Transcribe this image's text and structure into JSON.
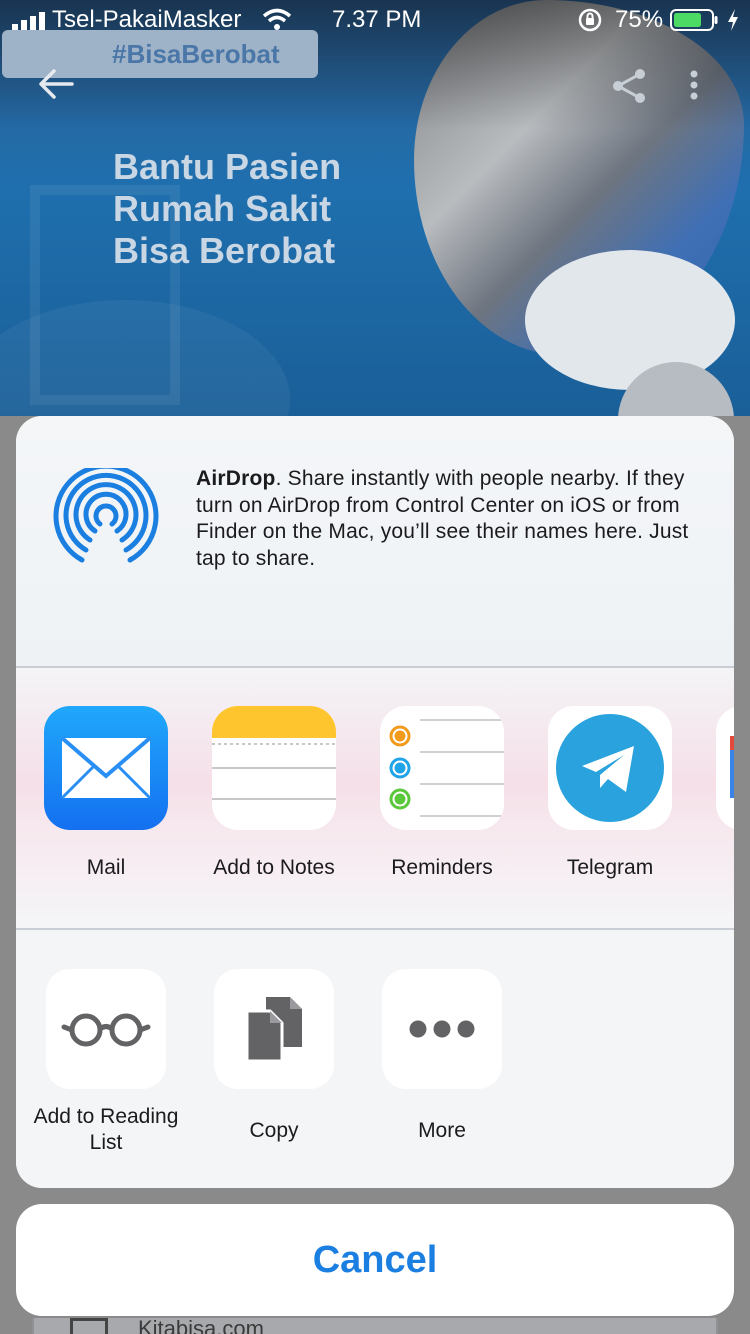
{
  "status_bar": {
    "carrier": "Tsel-PakaiMasker",
    "time": "7.37 PM",
    "battery_percent": "75%",
    "battery_level": 0.75,
    "battery_color": "#4cd964"
  },
  "background_page": {
    "hashtag": "#BisaBerobat",
    "hero_title": "Bantu Pasien Rumah Sakit Bisa Berobat",
    "footer_peek_text": "Kitabisa.com"
  },
  "share_sheet": {
    "airdrop": {
      "title": "AirDrop",
      "description": ". Share instantly with people nearby. If they turn on AirDrop from Control Center on iOS or from Finder on the Mac, you’ll see their names here. Just tap to share.",
      "icon": "airdrop-icon",
      "color": "#1a7fe0"
    },
    "apps": [
      {
        "label": "Mail",
        "icon": "mail-icon"
      },
      {
        "label": "Add to Notes",
        "icon": "notes-icon"
      },
      {
        "label": "Reminders",
        "icon": "reminders-icon"
      },
      {
        "label": "Telegram",
        "icon": "telegram-icon"
      }
    ],
    "actions": [
      {
        "label": "Add to Reading List",
        "icon": "glasses-icon"
      },
      {
        "label": "Copy",
        "icon": "copy-icon"
      },
      {
        "label": "More",
        "icon": "more-icon"
      }
    ]
  },
  "cancel": {
    "label": "Cancel",
    "color": "#1a7fe0"
  }
}
